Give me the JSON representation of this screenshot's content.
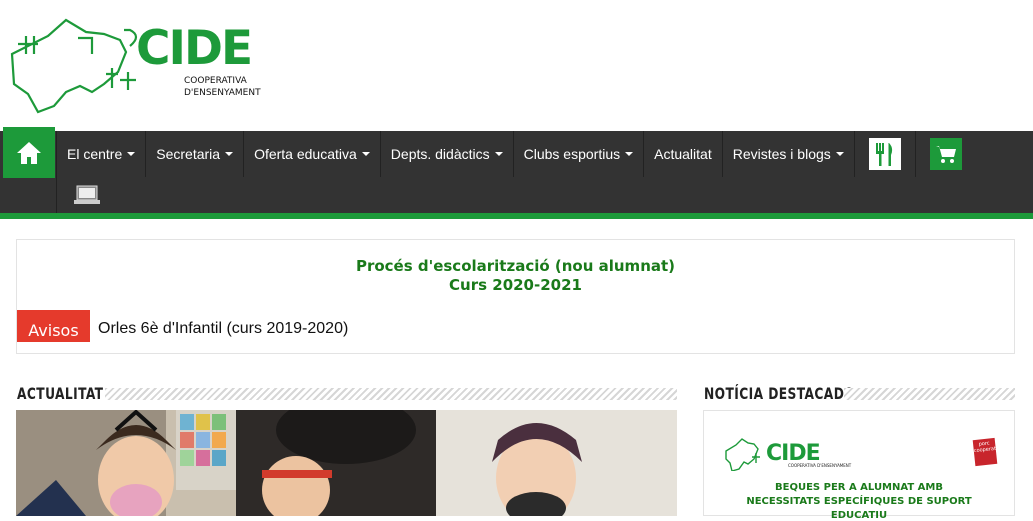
{
  "brand": {
    "name": "CIDE",
    "subtitle_line1": "COOPERATIVA",
    "subtitle_line2": "D'ENSENYAMENT",
    "color": "#1d9a3a"
  },
  "nav": {
    "home_icon": "home-icon",
    "items": [
      {
        "label": "El centre",
        "dropdown": true
      },
      {
        "label": "Secretaria",
        "dropdown": true
      },
      {
        "label": "Oferta educativa",
        "dropdown": true
      },
      {
        "label": "Depts. didàctics",
        "dropdown": true
      },
      {
        "label": "Clubs esportius",
        "dropdown": true
      },
      {
        "label": "Actualitat",
        "dropdown": false
      },
      {
        "label": "Revistes i blogs",
        "dropdown": true
      }
    ],
    "icons": [
      "cutlery-icon",
      "cart-icon",
      "laptop-icon"
    ],
    "bar_color": "#333333",
    "accent_color": "#1d9a3a"
  },
  "notice": {
    "title_line1": "Procés d'escolarització (nou alumnat)",
    "title_line2": "Curs 2020-2021",
    "avisos_label": "Avisos",
    "ticker_text": "Orles 6è d'Infantil (curs 2019-2020)",
    "avisos_color": "#e53a2c"
  },
  "sections": {
    "actualitat_title": "ACTUALITAT",
    "featured_title": "NOTÍCIA DESTACADA"
  },
  "featured": {
    "brand": "CIDE",
    "brand_sub": "COOPERATIVA D'ENSENYAMENT",
    "badge": "porc cooperativa",
    "line1": "BEQUES PER A ALUMNAT AMB",
    "line2": "NECESSITATS ESPECÍFIQUES DE SUPORT",
    "line3": "EDUCATIU"
  }
}
